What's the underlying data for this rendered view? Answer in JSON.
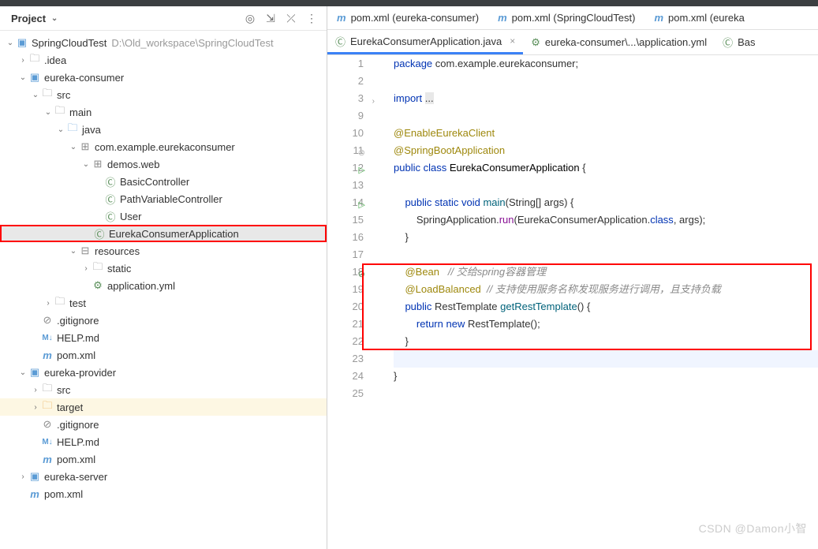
{
  "sidebar": {
    "title": "Project",
    "actions": [
      "target",
      "expand",
      "collapse",
      "more"
    ],
    "root": {
      "label": "SpringCloudTest",
      "path": "D:\\Old_workspace\\SpringCloudTest"
    },
    "nodes": {
      "idea": ".idea",
      "eurekaConsumer": "eureka-consumer",
      "src": "src",
      "main": "main",
      "java": "java",
      "pkg": "com.example.eurekaconsumer",
      "demos": "demos.web",
      "basic": "BasicController",
      "pathvar": "PathVariableController",
      "user": "User",
      "app": "EurekaConsumerApplication",
      "resources": "resources",
      "static": "static",
      "appyml": "application.yml",
      "test": "test",
      "gitignore": ".gitignore",
      "help": "HELP.md",
      "pom": "pom.xml",
      "eurekaProvider": "eureka-provider",
      "srcP": "src",
      "targetP": "target",
      "gitignoreP": ".gitignore",
      "helpP": "HELP.md",
      "pomP": "pom.xml",
      "eurekaServer": "eureka-server",
      "pomRoot": "pom.xml"
    }
  },
  "tabs": {
    "top": [
      {
        "label": "pom.xml (eureka-consumer)",
        "icon": "m"
      },
      {
        "label": "pom.xml (SpringCloudTest)",
        "icon": "m"
      },
      {
        "label": "pom.xml (eureka",
        "icon": "m"
      }
    ],
    "sub": [
      {
        "label": "EurekaConsumerApplication.java",
        "icon": "class",
        "active": true
      },
      {
        "label": "eureka-consumer\\...\\application.yml",
        "icon": "yml",
        "active": false
      },
      {
        "label": "Bas",
        "icon": "class",
        "active": false
      }
    ]
  },
  "code": {
    "lines": [
      {
        "n": 1,
        "html": "<span class='kw'>package</span> com.example.eurekaconsumer;"
      },
      {
        "n": 2,
        "html": ""
      },
      {
        "n": 3,
        "html": "<span class='kw'>import</span> <span style='background:#e8e8e8'>...</span>",
        "fold": true
      },
      {
        "n": 9,
        "html": ""
      },
      {
        "n": 10,
        "html": "<span class='ann'>@EnableEurekaClient</span>"
      },
      {
        "n": 11,
        "html": "<span class='ann'>@SpringBootApplication</span>",
        "gicon": "forbid"
      },
      {
        "n": 12,
        "html": "<span class='kw'>public class</span> <span class='cls'>EurekaConsumerApplication</span> {",
        "gicon": "run"
      },
      {
        "n": 13,
        "html": ""
      },
      {
        "n": 14,
        "html": "    <span class='kw'>public static void</span> <span class='mtd'>main</span>(String[] args) {",
        "gicon": "run"
      },
      {
        "n": 15,
        "html": "        SpringApplication.<span class='fld'>run</span>(EurekaConsumerApplication.<span class='kw'>class</span>, args);"
      },
      {
        "n": 16,
        "html": "    }"
      },
      {
        "n": 17,
        "html": ""
      },
      {
        "n": 18,
        "html": "    <span class='ann'>@Bean</span>   <span class='cmt'>// 交给spring容器管理</span>",
        "gicon": "forbid-g"
      },
      {
        "n": 19,
        "html": "    <span class='ann'>@LoadBalanced</span>  <span class='cmt'>// 支持使用服务名称发现服务进行调用，且支持负载</span>"
      },
      {
        "n": 20,
        "html": "    <span class='kw'>public</span> RestTemplate <span class='mtd'>getRestTemplate</span>() {"
      },
      {
        "n": 21,
        "html": "        <span class='kw'>return new</span> RestTemplate();"
      },
      {
        "n": 22,
        "html": "    }"
      },
      {
        "n": 23,
        "html": ""
      },
      {
        "n": 24,
        "html": "}"
      },
      {
        "n": 25,
        "html": ""
      }
    ]
  },
  "watermark": "CSDN @Damon小智"
}
